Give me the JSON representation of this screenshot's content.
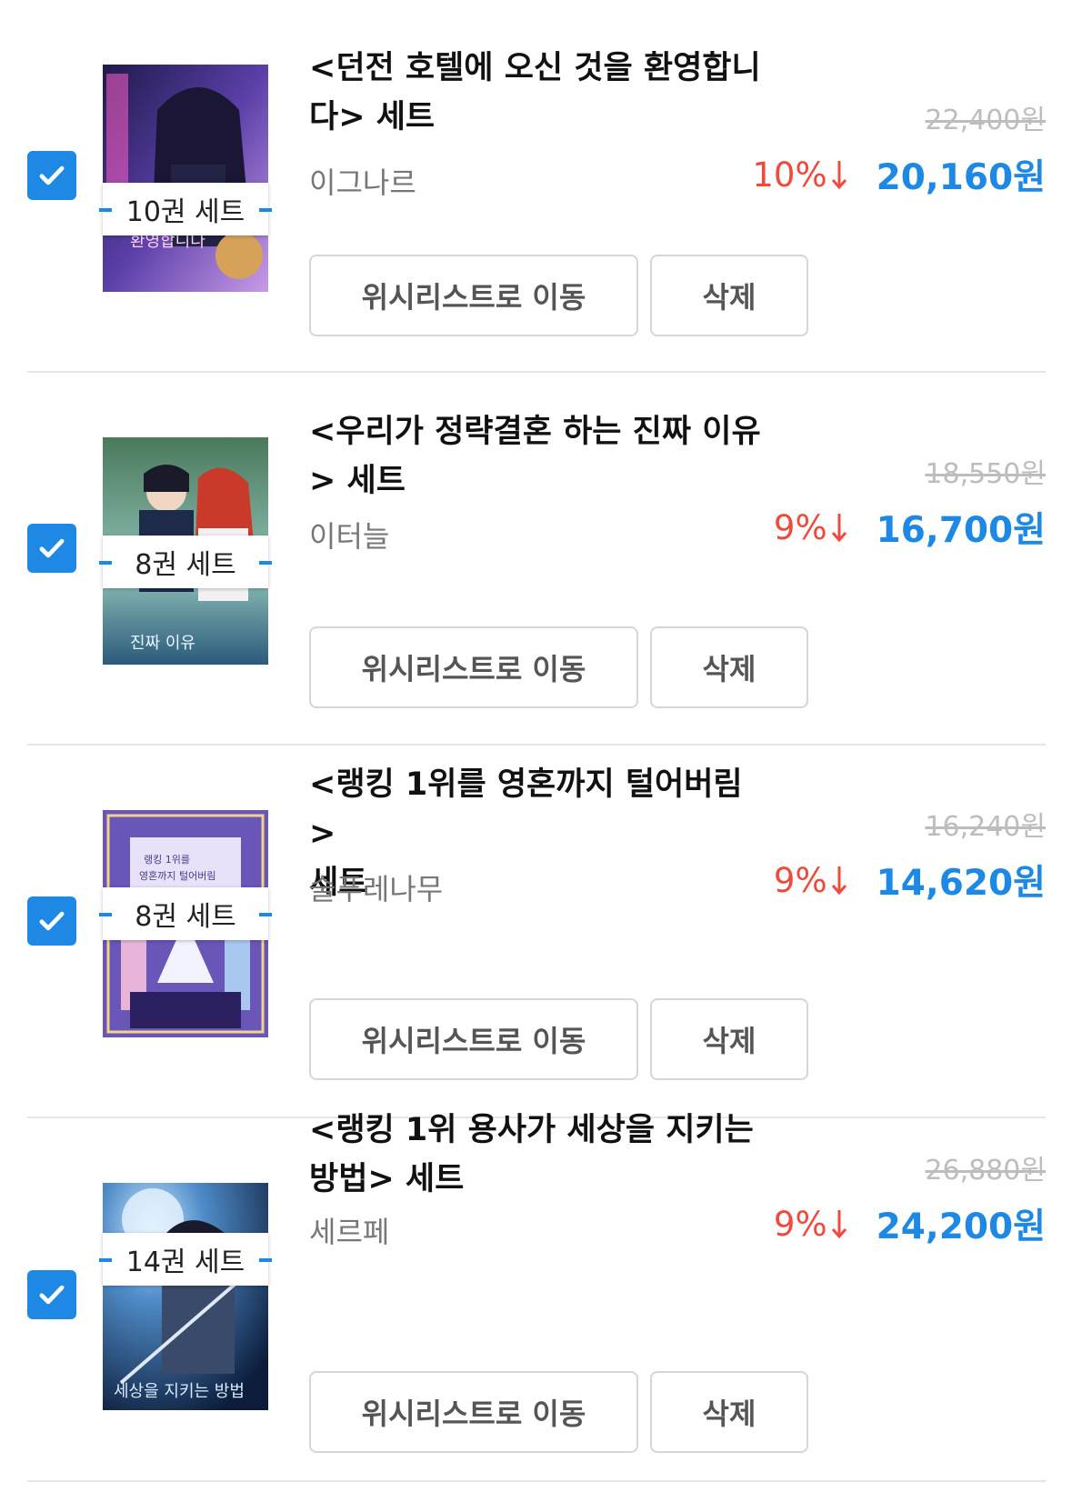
{
  "cart": {
    "items": [
      {
        "title_line1": "<던전 호텔에 오신 것을 환영합니",
        "title_line2": "다> 세트",
        "author": "이그나르",
        "set_badge": "10권 세트",
        "original_price": "22,400원",
        "discount": "10%",
        "sale_price": "20,160원",
        "checked": true,
        "cover_colors": [
          "#3a2f6b",
          "#7b5bd6",
          "#d9a6ff"
        ]
      },
      {
        "title_line1": "<우리가 정략결혼 하는 진짜 이유",
        "title_line2": "> 세트",
        "author": "이터늘",
        "set_badge": "8권 세트",
        "original_price": "18,550원",
        "discount": "9%",
        "sale_price": "16,700원",
        "checked": true,
        "cover_colors": [
          "#2e5a4a",
          "#7fb0a0",
          "#c94a3a"
        ]
      },
      {
        "title_line1": "<랭킹 1위를 영혼까지 털어버림>",
        "title_line2": "세트",
        "author": "술푸레나무",
        "set_badge": "8권 세트",
        "original_price": "16,240원",
        "discount": "9%",
        "sale_price": "14,620원",
        "checked": true,
        "cover_colors": [
          "#6a55b8",
          "#a894e6",
          "#f0d48a"
        ]
      },
      {
        "title_line1": "<랭킹 1위 용사가 세상을 지키는",
        "title_line2": "방법> 세트",
        "author": "세르페",
        "set_badge": "14권 세트",
        "original_price": "26,880원",
        "discount": "9%",
        "sale_price": "24,200원",
        "checked": true,
        "cover_colors": [
          "#0f2a4a",
          "#3c7fc0",
          "#c8e4ff"
        ]
      }
    ],
    "wishlist_button_label": "위시리스트로 이동",
    "delete_button_label": "삭제"
  },
  "colors": {
    "accent": "#1e88e5",
    "discount": "#ef4a3c",
    "muted": "#777777",
    "strike": "#bdbdbd"
  }
}
